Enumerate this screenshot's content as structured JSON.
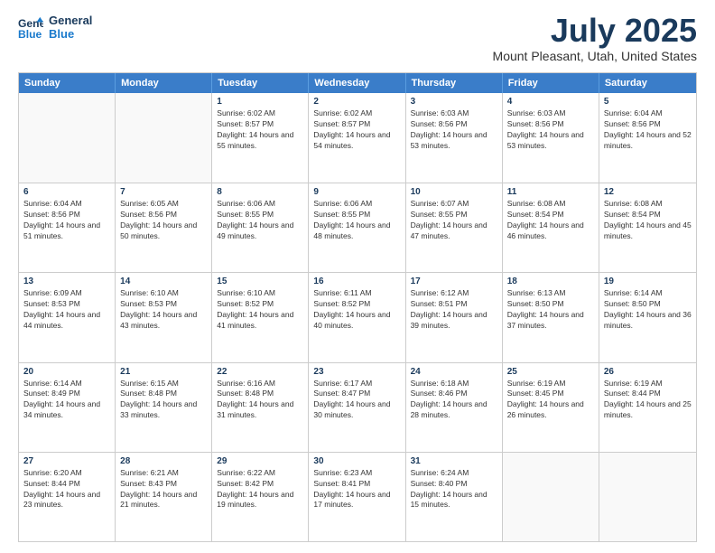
{
  "logo": {
    "line1": "General",
    "line2": "Blue"
  },
  "header": {
    "month_year": "July 2025",
    "location": "Mount Pleasant, Utah, United States"
  },
  "days_of_week": [
    "Sunday",
    "Monday",
    "Tuesday",
    "Wednesday",
    "Thursday",
    "Friday",
    "Saturday"
  ],
  "weeks": [
    [
      {
        "day": "",
        "empty": true
      },
      {
        "day": "",
        "empty": true
      },
      {
        "day": "1",
        "sunrise": "Sunrise: 6:02 AM",
        "sunset": "Sunset: 8:57 PM",
        "daylight": "Daylight: 14 hours and 55 minutes."
      },
      {
        "day": "2",
        "sunrise": "Sunrise: 6:02 AM",
        "sunset": "Sunset: 8:57 PM",
        "daylight": "Daylight: 14 hours and 54 minutes."
      },
      {
        "day": "3",
        "sunrise": "Sunrise: 6:03 AM",
        "sunset": "Sunset: 8:56 PM",
        "daylight": "Daylight: 14 hours and 53 minutes."
      },
      {
        "day": "4",
        "sunrise": "Sunrise: 6:03 AM",
        "sunset": "Sunset: 8:56 PM",
        "daylight": "Daylight: 14 hours and 53 minutes."
      },
      {
        "day": "5",
        "sunrise": "Sunrise: 6:04 AM",
        "sunset": "Sunset: 8:56 PM",
        "daylight": "Daylight: 14 hours and 52 minutes."
      }
    ],
    [
      {
        "day": "6",
        "sunrise": "Sunrise: 6:04 AM",
        "sunset": "Sunset: 8:56 PM",
        "daylight": "Daylight: 14 hours and 51 minutes."
      },
      {
        "day": "7",
        "sunrise": "Sunrise: 6:05 AM",
        "sunset": "Sunset: 8:56 PM",
        "daylight": "Daylight: 14 hours and 50 minutes."
      },
      {
        "day": "8",
        "sunrise": "Sunrise: 6:06 AM",
        "sunset": "Sunset: 8:55 PM",
        "daylight": "Daylight: 14 hours and 49 minutes."
      },
      {
        "day": "9",
        "sunrise": "Sunrise: 6:06 AM",
        "sunset": "Sunset: 8:55 PM",
        "daylight": "Daylight: 14 hours and 48 minutes."
      },
      {
        "day": "10",
        "sunrise": "Sunrise: 6:07 AM",
        "sunset": "Sunset: 8:55 PM",
        "daylight": "Daylight: 14 hours and 47 minutes."
      },
      {
        "day": "11",
        "sunrise": "Sunrise: 6:08 AM",
        "sunset": "Sunset: 8:54 PM",
        "daylight": "Daylight: 14 hours and 46 minutes."
      },
      {
        "day": "12",
        "sunrise": "Sunrise: 6:08 AM",
        "sunset": "Sunset: 8:54 PM",
        "daylight": "Daylight: 14 hours and 45 minutes."
      }
    ],
    [
      {
        "day": "13",
        "sunrise": "Sunrise: 6:09 AM",
        "sunset": "Sunset: 8:53 PM",
        "daylight": "Daylight: 14 hours and 44 minutes."
      },
      {
        "day": "14",
        "sunrise": "Sunrise: 6:10 AM",
        "sunset": "Sunset: 8:53 PM",
        "daylight": "Daylight: 14 hours and 43 minutes."
      },
      {
        "day": "15",
        "sunrise": "Sunrise: 6:10 AM",
        "sunset": "Sunset: 8:52 PM",
        "daylight": "Daylight: 14 hours and 41 minutes."
      },
      {
        "day": "16",
        "sunrise": "Sunrise: 6:11 AM",
        "sunset": "Sunset: 8:52 PM",
        "daylight": "Daylight: 14 hours and 40 minutes."
      },
      {
        "day": "17",
        "sunrise": "Sunrise: 6:12 AM",
        "sunset": "Sunset: 8:51 PM",
        "daylight": "Daylight: 14 hours and 39 minutes."
      },
      {
        "day": "18",
        "sunrise": "Sunrise: 6:13 AM",
        "sunset": "Sunset: 8:50 PM",
        "daylight": "Daylight: 14 hours and 37 minutes."
      },
      {
        "day": "19",
        "sunrise": "Sunrise: 6:14 AM",
        "sunset": "Sunset: 8:50 PM",
        "daylight": "Daylight: 14 hours and 36 minutes."
      }
    ],
    [
      {
        "day": "20",
        "sunrise": "Sunrise: 6:14 AM",
        "sunset": "Sunset: 8:49 PM",
        "daylight": "Daylight: 14 hours and 34 minutes."
      },
      {
        "day": "21",
        "sunrise": "Sunrise: 6:15 AM",
        "sunset": "Sunset: 8:48 PM",
        "daylight": "Daylight: 14 hours and 33 minutes."
      },
      {
        "day": "22",
        "sunrise": "Sunrise: 6:16 AM",
        "sunset": "Sunset: 8:48 PM",
        "daylight": "Daylight: 14 hours and 31 minutes."
      },
      {
        "day": "23",
        "sunrise": "Sunrise: 6:17 AM",
        "sunset": "Sunset: 8:47 PM",
        "daylight": "Daylight: 14 hours and 30 minutes."
      },
      {
        "day": "24",
        "sunrise": "Sunrise: 6:18 AM",
        "sunset": "Sunset: 8:46 PM",
        "daylight": "Daylight: 14 hours and 28 minutes."
      },
      {
        "day": "25",
        "sunrise": "Sunrise: 6:19 AM",
        "sunset": "Sunset: 8:45 PM",
        "daylight": "Daylight: 14 hours and 26 minutes."
      },
      {
        "day": "26",
        "sunrise": "Sunrise: 6:19 AM",
        "sunset": "Sunset: 8:44 PM",
        "daylight": "Daylight: 14 hours and 25 minutes."
      }
    ],
    [
      {
        "day": "27",
        "sunrise": "Sunrise: 6:20 AM",
        "sunset": "Sunset: 8:44 PM",
        "daylight": "Daylight: 14 hours and 23 minutes."
      },
      {
        "day": "28",
        "sunrise": "Sunrise: 6:21 AM",
        "sunset": "Sunset: 8:43 PM",
        "daylight": "Daylight: 14 hours and 21 minutes."
      },
      {
        "day": "29",
        "sunrise": "Sunrise: 6:22 AM",
        "sunset": "Sunset: 8:42 PM",
        "daylight": "Daylight: 14 hours and 19 minutes."
      },
      {
        "day": "30",
        "sunrise": "Sunrise: 6:23 AM",
        "sunset": "Sunset: 8:41 PM",
        "daylight": "Daylight: 14 hours and 17 minutes."
      },
      {
        "day": "31",
        "sunrise": "Sunrise: 6:24 AM",
        "sunset": "Sunset: 8:40 PM",
        "daylight": "Daylight: 14 hours and 15 minutes."
      },
      {
        "day": "",
        "empty": true
      },
      {
        "day": "",
        "empty": true
      }
    ]
  ]
}
